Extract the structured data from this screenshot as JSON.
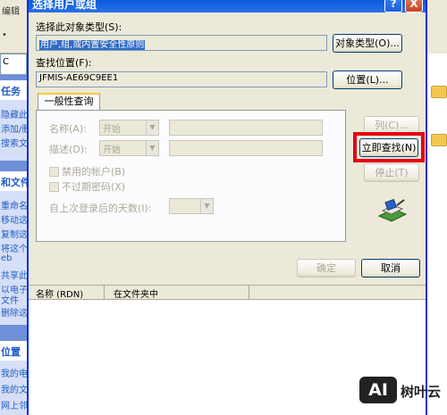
{
  "background": {
    "toolbar_items": [
      "编辑",
      "•"
    ],
    "address_prefix": "C",
    "sections": [
      {
        "title": "任务",
        "links": [
          "隐藏此",
          "添加/删",
          "搜索文"
        ]
      },
      {
        "title": "和文件",
        "links": [
          "重命名",
          "移动这",
          "复制这",
          "将这个",
          "eb",
          "共享此",
          "以电子",
          "文件",
          "删除这"
        ]
      },
      {
        "title": "位置",
        "links": [
          "我的电",
          "我的文",
          "网上邻"
        ]
      }
    ]
  },
  "dialog": {
    "title": "选择用户或组",
    "help_button": "?",
    "close_button": "X",
    "object_type_label": "选择此对象类型(S):",
    "object_type_value": "用户,组,或内置安全性原则",
    "object_type_button": "对象类型(O)...",
    "location_label": "查找位置(F):",
    "location_value": "JFMIS-AE69C9EE1",
    "location_button": "位置(L)...",
    "tab_label": "一般性查询",
    "name_label": "名称(A):",
    "name_mode": "开始",
    "desc_label": "描述(D):",
    "desc_mode": "开始",
    "disabled_accounts": "禁用的帐户(B)",
    "non_expiring_passwords": "不过期密码(X)",
    "days_since_logon": "自上次登录后的天数(I):",
    "columns_button": "列(C)...",
    "find_now_button": "立即查找(N)",
    "stop_button": "停止(T)",
    "ok_button": "确定",
    "cancel_button": "取消",
    "results_columns": [
      "名称 (RDN)",
      "在文件夹中"
    ]
  },
  "watermark": {
    "logo": "AI",
    "text": "树叶云"
  }
}
